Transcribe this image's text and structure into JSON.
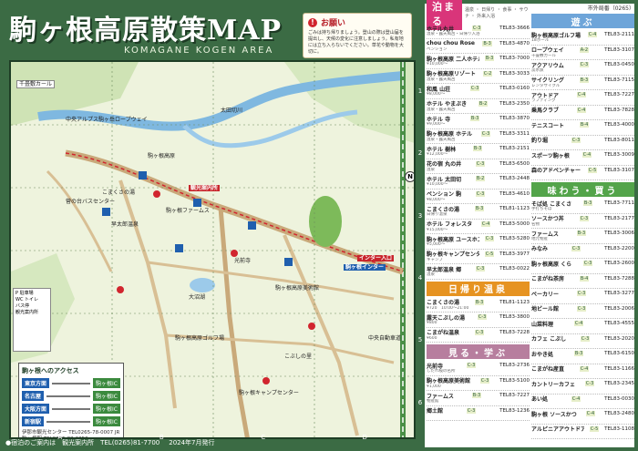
{
  "header": {
    "title": "駒ヶ根高原散策MAP",
    "subtitle": "KOMAGANE KOGEN AREA"
  },
  "notice": {
    "heading": "お願い",
    "body": "ごみは持ち帰りましょう。登山の際は登山届を提出し、天候の変化に注意しましょう。私有地には立ち入らないでください。草花や動物を大切に。"
  },
  "map": {
    "labels": [
      "千畳敷カール",
      "駒ヶ根高原",
      "こまくさの湯",
      "観光案内所",
      "菅の台バスセンター",
      "早太郎温泉",
      "光前寺",
      "駒ヶ根ファームス",
      "駒ヶ根高原美術館",
      "大沼湖",
      "駒ヶ根インター",
      "インター入口",
      "中央アルプス駒ヶ岳ロープウェイ",
      "太田切川",
      "駒ヶ根キャンプセンター",
      "こぶしの里",
      "駒ヶ根高原ゴルフ場",
      "中央自動車道"
    ],
    "grid_cols": [
      "A",
      "B",
      "C",
      "D"
    ],
    "grid_rows": [
      "1",
      "2",
      "3",
      "4",
      "5",
      "6"
    ],
    "legend": [
      "P 駐車場",
      "WC トイレ",
      "バス停",
      "観光案内所"
    ],
    "north": "N"
  },
  "access": {
    "title": "駒ヶ根へのアクセス",
    "routes": [
      {
        "from": "東京方面",
        "to": "駒ヶ根IC"
      },
      {
        "from": "名古屋",
        "to": "駒ヶ根IC"
      },
      {
        "from": "大阪方面",
        "to": "駒ヶ根IC"
      },
      {
        "from": "新宿駅",
        "to": "駒ヶ根IC"
      }
    ],
    "center_info": "伊那市観光センター TEL0265-78-0007 JR駒ヶ根駅 TEL0265-82-2050"
  },
  "footer": {
    "info": "●宿泊のご案内は　観光案内所　TEL(0265)81-7700",
    "issued": "2024年7月発行"
  },
  "right": {
    "phone_code": "市外局番（0265）",
    "stay_title": "泊まる",
    "stay_icons": "温泉 ・ 日帰り ・ 食事 ・ サウナ ・ 外来入浴",
    "stay": [
      {
        "name": "ホテル丸井",
        "code": "C-3",
        "tel": "TEL83-3666",
        "desc": "温泉・露天風呂・日帰り入浴",
        "price": ""
      },
      {
        "name": "chou chou Rose",
        "code": "B-3",
        "tel": "TEL83-4870",
        "desc": "ペンション",
        "price": ""
      },
      {
        "name": "駒ヶ根高原 二人ホテル",
        "code": "B-3",
        "tel": "TEL83-7000",
        "desc": "¥10,000〜",
        "price": ""
      },
      {
        "name": "駒ヶ根高原リゾート",
        "code": "C-2",
        "tel": "TEL83-3033",
        "desc": "温泉・露天風呂",
        "price": ""
      },
      {
        "name": "和風 山荘",
        "code": "C-3",
        "tel": "TEL83-0160",
        "desc": "¥8,000〜",
        "price": ""
      },
      {
        "name": "ホテル やまぶき",
        "code": "B-2",
        "tel": "TEL83-2350",
        "desc": "温泉・露天風呂",
        "price": ""
      },
      {
        "name": "ホテル 寺",
        "code": "B-3",
        "tel": "TEL83-3870",
        "desc": "¥9,000〜",
        "price": ""
      },
      {
        "name": "駒ヶ根高原 ホテル",
        "code": "C-3",
        "tel": "TEL83-3311",
        "desc": "温泉・露天風呂",
        "price": ""
      },
      {
        "name": "ホテル 樹林",
        "code": "B-3",
        "tel": "TEL83-2151",
        "desc": "¥12,000〜",
        "price": ""
      },
      {
        "name": "花の宿 丸の井",
        "code": "C-3",
        "tel": "TEL83-6500",
        "desc": "温泉",
        "price": ""
      },
      {
        "name": "ホテル 太田切",
        "code": "B-2",
        "tel": "TEL83-2448",
        "desc": "¥10,000〜",
        "price": ""
      },
      {
        "name": "ペンション 駒",
        "code": "C-3",
        "tel": "TEL83-4610",
        "desc": "¥8,000〜",
        "price": ""
      },
      {
        "name": "こまくさの湯",
        "code": "B-3",
        "tel": "TEL81-1123",
        "desc": "日帰り温泉",
        "price": ""
      },
      {
        "name": "ホテル フォレスタ",
        "code": "C-4",
        "tel": "TEL83-5000",
        "desc": "¥15,000〜",
        "price": ""
      },
      {
        "name": "駒ヶ根高原 ユースホステル",
        "code": "C-3",
        "tel": "TEL83-5280",
        "desc": "¥5,000〜",
        "price": ""
      },
      {
        "name": "駒ヶ根キャンプセンター",
        "code": "C-5",
        "tel": "TEL83-3977",
        "desc": "キャンプ",
        "price": ""
      },
      {
        "name": "早太郎温泉 郷",
        "code": "C-3",
        "tel": "TEL83-0022",
        "desc": "温泉",
        "price": ""
      }
    ],
    "onsen_title": "日帰り温泉",
    "onsen": [
      {
        "name": "こまくさの湯",
        "code": "B-3",
        "tel": "TEL81-1123",
        "desc": "¥720　10:00〜21:00"
      },
      {
        "name": "露天こぶしの湯",
        "code": "C-3",
        "tel": "TEL83-3800",
        "desc": "¥800"
      },
      {
        "name": "こまがね温泉",
        "code": "C-3",
        "tel": "TEL83-7228",
        "desc": "¥600"
      }
    ],
    "learn_title": "見る・学ぶ",
    "learn": [
      {
        "name": "光前寺",
        "code": "C-3",
        "tel": "TEL83-2736",
        "desc": "しだれ桜の名所"
      },
      {
        "name": "駒ヶ根高原美術館",
        "code": "C-3",
        "tel": "TEL83-5100",
        "desc": "¥1,000"
      },
      {
        "name": "ファームス",
        "code": "B-3",
        "tel": "TEL83-7227",
        "desc": "物産館"
      },
      {
        "name": "郷土館",
        "code": "C-3",
        "tel": "TEL83-1236",
        "desc": ""
      }
    ],
    "play_title": "遊ぶ",
    "play": [
      {
        "name": "駒ヶ根高原ゴルフ場",
        "code": "C-4",
        "tel": "TEL83-2111",
        "desc": "18ホール"
      },
      {
        "name": "ロープウェイ",
        "code": "A-2",
        "tel": "TEL83-3107",
        "desc": "千畳敷カール"
      },
      {
        "name": "アクアリウム",
        "code": "C-3",
        "tel": "TEL83-0450",
        "desc": "淡水魚"
      },
      {
        "name": "サイクリング",
        "code": "B-3",
        "tel": "TEL83-7115",
        "desc": "レンタサイクル"
      },
      {
        "name": "アウトドア",
        "code": "C-4",
        "tel": "TEL83-7227",
        "desc": "ラフティング"
      },
      {
        "name": "乗馬クラブ",
        "code": "C-4",
        "tel": "TEL83-7828",
        "desc": ""
      },
      {
        "name": "テニスコート",
        "code": "B-4",
        "tel": "TEL83-4000",
        "desc": ""
      },
      {
        "name": "釣り堀",
        "code": "C-3",
        "tel": "TEL83-8011",
        "desc": ""
      },
      {
        "name": "スポーツ駒ヶ根",
        "code": "C-4",
        "tel": "TEL83-3009",
        "desc": ""
      },
      {
        "name": "森のアドベンチャー",
        "code": "C-5",
        "tel": "TEL83-3107",
        "desc": ""
      }
    ],
    "eat_title": "味わう・買う",
    "eat": [
      {
        "name": "そば処 こまくさ",
        "code": "B-3",
        "tel": "TEL83-7711",
        "desc": "手打ちそば"
      },
      {
        "name": "ソースかつ丼",
        "code": "C-3",
        "tel": "TEL83-2177",
        "desc": "名物"
      },
      {
        "name": "ファームス",
        "code": "B-3",
        "tel": "TEL83-3006",
        "desc": "地元物産"
      },
      {
        "name": "みなみ",
        "code": "C-3",
        "tel": "TEL83-2200",
        "desc": ""
      },
      {
        "name": "駒ヶ根高原 くら",
        "code": "C-3",
        "tel": "TEL83-2600",
        "desc": ""
      },
      {
        "name": "こまがね茶房",
        "code": "B-4",
        "tel": "TEL83-7288",
        "desc": ""
      },
      {
        "name": "ベーカリー",
        "code": "C-3",
        "tel": "TEL83-3277",
        "desc": ""
      },
      {
        "name": "地ビール館",
        "code": "C-3",
        "tel": "TEL83-2006",
        "desc": ""
      },
      {
        "name": "山菜料理",
        "code": "C-4",
        "tel": "TEL83-4555",
        "desc": ""
      },
      {
        "name": "カフェ こぶし",
        "code": "C-3",
        "tel": "TEL83-2020",
        "desc": ""
      },
      {
        "name": "おやき処",
        "code": "B-3",
        "tel": "TEL83-6150",
        "desc": ""
      },
      {
        "name": "こまがね産直",
        "code": "C-4",
        "tel": "TEL83-1166",
        "desc": ""
      },
      {
        "name": "カントリーカフェ",
        "code": "C-3",
        "tel": "TEL83-2345",
        "desc": ""
      },
      {
        "name": "あい処",
        "code": "C-4",
        "tel": "TEL83-0030",
        "desc": ""
      },
      {
        "name": "駒ヶ根 ソースかつ",
        "code": "C-4",
        "tel": "TEL83-2480",
        "desc": ""
      },
      {
        "name": "アルピニアアウトドア",
        "code": "C-5",
        "tel": "TEL83-1108",
        "desc": ""
      }
    ]
  }
}
